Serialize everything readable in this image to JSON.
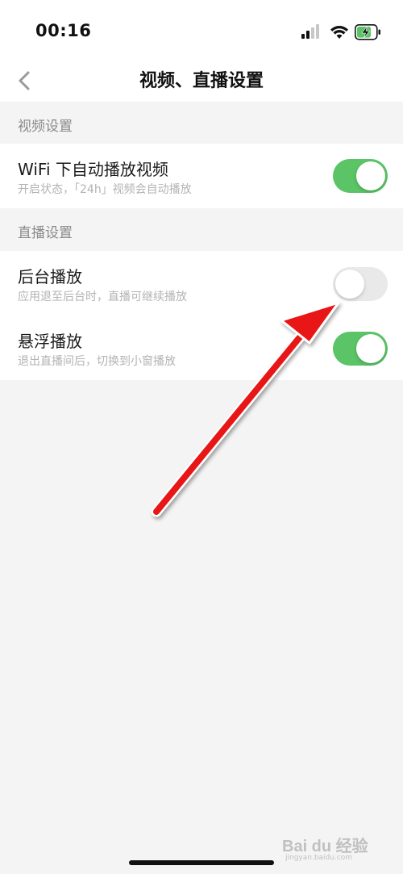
{
  "status_bar": {
    "time": "00:16",
    "icons": [
      "signal-icon",
      "wifi-icon",
      "battery-charging-icon"
    ],
    "battery_color": "#5ac466"
  },
  "nav": {
    "title": "视频、直播设置",
    "back_icon": "chevron-left-icon"
  },
  "sections": [
    {
      "title": "视频设置",
      "items": [
        {
          "title": "WiFi 下自动播放视频",
          "subtitle": "开启状态，「24h」视频会自动播放",
          "enabled": true
        }
      ]
    },
    {
      "title": "直播设置",
      "items": [
        {
          "title": "后台播放",
          "subtitle": "应用退至后台时，直播可继续播放",
          "enabled": false
        },
        {
          "title": "悬浮播放",
          "subtitle": "退出直播间后，切换到小窗播放",
          "enabled": true
        }
      ]
    }
  ],
  "colors": {
    "toggle_on": "#5ac466",
    "toggle_off": "#e9e9ea",
    "annotation_arrow": "#e81818"
  },
  "watermark": {
    "logo_text": "Bai du 经验",
    "url_text": "jingyan.baidu.com"
  }
}
